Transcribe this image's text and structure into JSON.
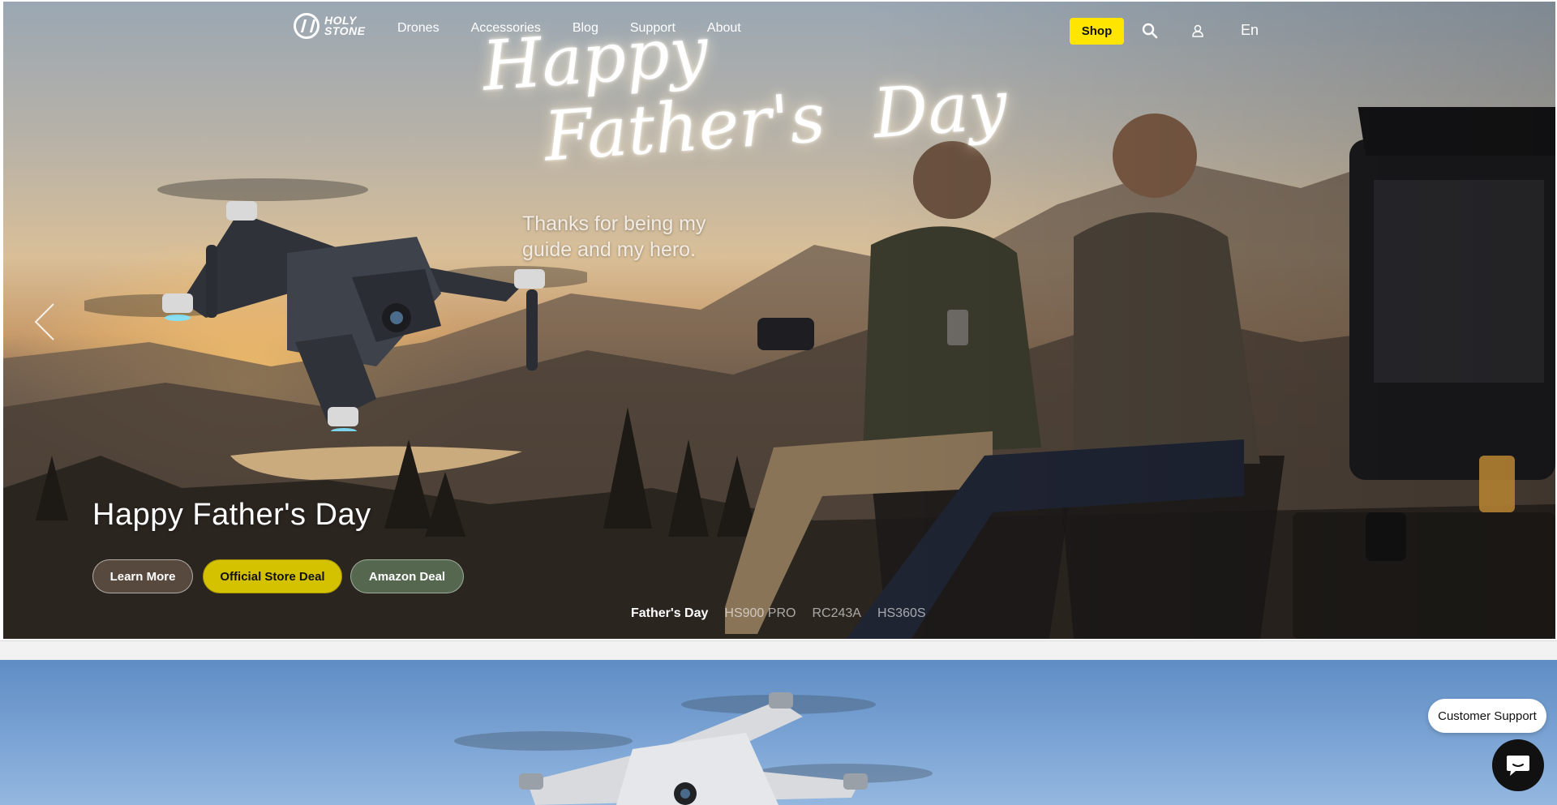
{
  "header": {
    "logo_text_line1": "HOLY",
    "logo_text_line2": "STONE",
    "nav": [
      "Drones",
      "Accessories",
      "Blog",
      "Support",
      "About"
    ],
    "shop_label": "Shop",
    "language": "En"
  },
  "hero": {
    "script_line1": "Happy",
    "script_line2a": "Father's",
    "script_line2b": "Day",
    "tagline": "Thanks for being my guide and my hero.",
    "slide_title": "Happy Father's Day",
    "buttons": {
      "learn_more": "Learn More",
      "official_store": "Official Store Deal",
      "amazon": "Amazon Deal"
    },
    "slide_tabs": [
      "Father's Day",
      "HS900 PRO",
      "RC243A",
      "HS360S"
    ],
    "active_tab": "Father's Day"
  },
  "support": {
    "label": "Customer Support"
  },
  "colors": {
    "shop_yellow": "#ffe500",
    "official_deal": "#d4c100",
    "amazon_green": "#55684f",
    "chat_black": "#111111"
  }
}
